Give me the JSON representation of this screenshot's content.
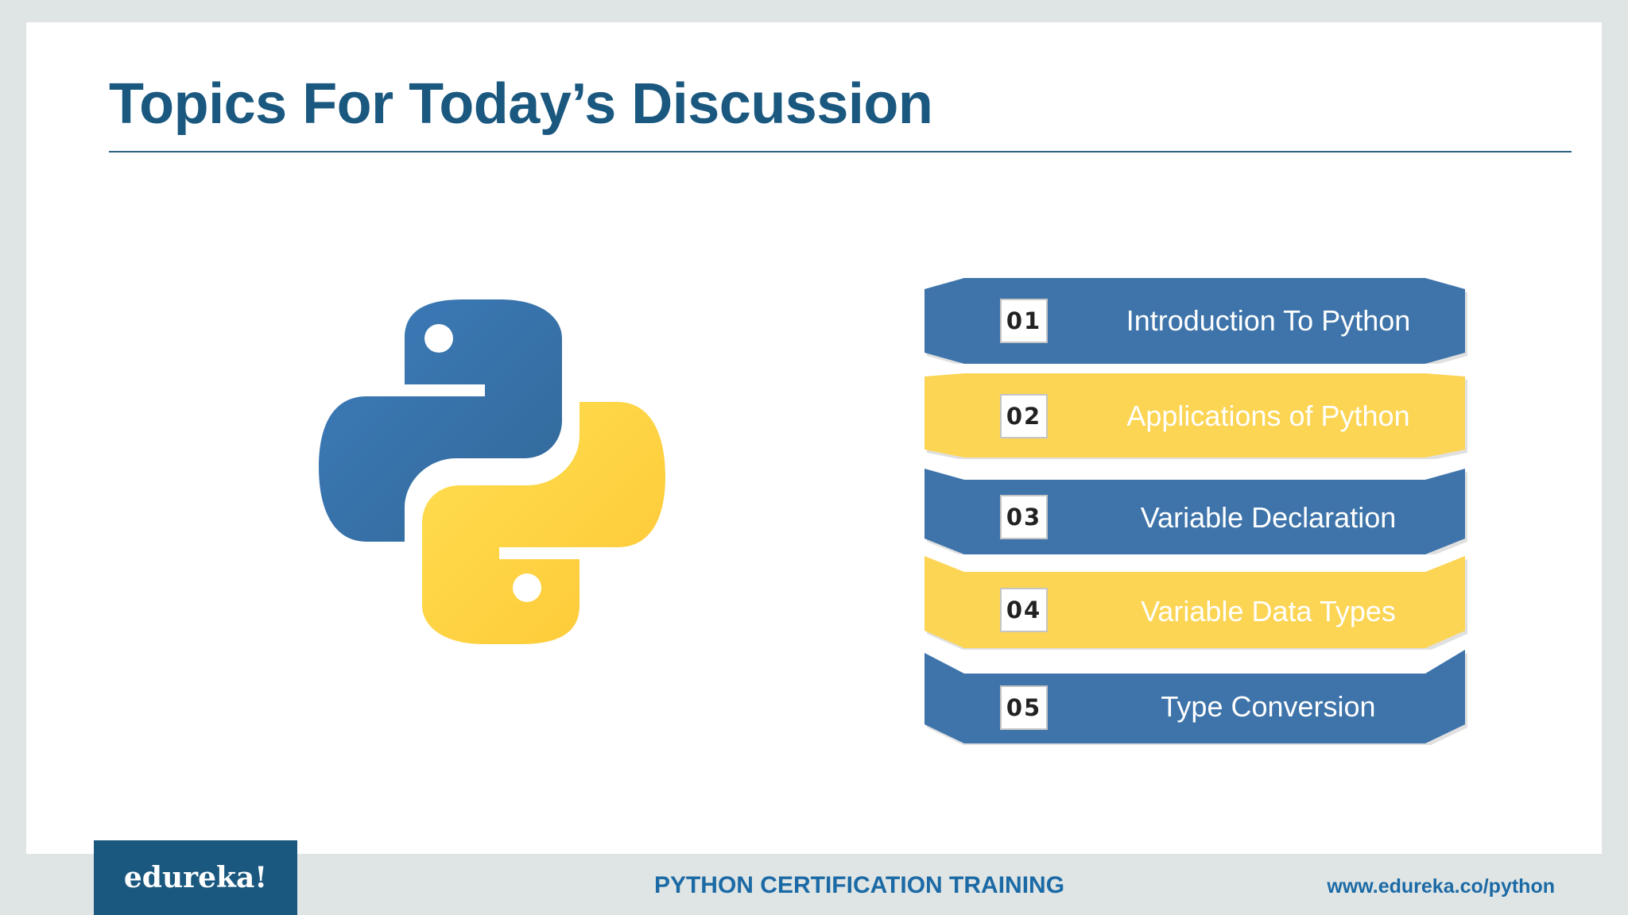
{
  "slide": {
    "title": "Topics For Today’s Discussion"
  },
  "logo": {
    "icon": "python-logo-icon",
    "colors": {
      "blue": "#3a75ad",
      "yellow": "#fdd74a"
    }
  },
  "topics": [
    {
      "number": "01",
      "label": "Introduction To Python",
      "color": "#3e74aa"
    },
    {
      "number": "02",
      "label": "Applications of Python",
      "color": "#fcd555"
    },
    {
      "number": "03",
      "label": "Variable Declaration",
      "color": "#3e74aa"
    },
    {
      "number": "04",
      "label": "Variable Data Types",
      "color": "#fcd555"
    },
    {
      "number": "05",
      "label": "Type Conversion",
      "color": "#3e74aa"
    }
  ],
  "footer": {
    "brand": "edureka!",
    "course": "PYTHON CERTIFICATION TRAINING",
    "url": "www.edureka.co/python"
  }
}
